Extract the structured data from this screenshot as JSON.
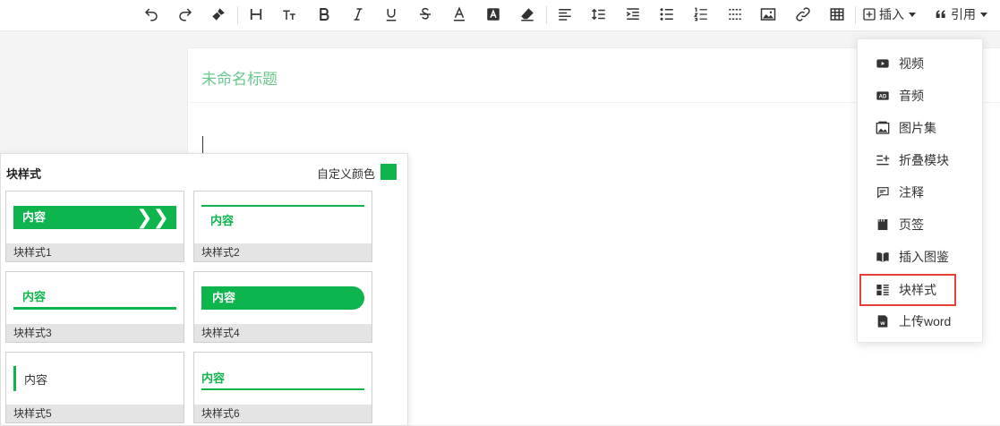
{
  "toolbar": {
    "buttons": [
      "undo-icon",
      "redo-icon",
      "format-brush-icon",
      "heading-icon",
      "font-size-icon",
      "bold-icon",
      "italic-icon",
      "underline-icon",
      "strikethrough-icon",
      "font-color-icon",
      "background-color-icon",
      "eraser-icon",
      "align-icon",
      "line-height-icon",
      "indent-icon",
      "unordered-list-icon",
      "ordered-list-icon",
      "horizontal-rule-icon",
      "image-icon",
      "link-icon",
      "table-icon"
    ],
    "insert_label": "插入",
    "quote_label": "引用"
  },
  "editor": {
    "title_placeholder": "未命名标题"
  },
  "block_panel": {
    "title": "块样式",
    "custom_color_label": "自定义颜色",
    "accent_color": "#0db54c",
    "sample_text": "内容",
    "styles": [
      {
        "name": "块样式1",
        "sample": "内容"
      },
      {
        "name": "块样式2",
        "sample": "内容"
      },
      {
        "name": "块样式3",
        "sample": "内容"
      },
      {
        "name": "块样式4",
        "sample": "内容"
      },
      {
        "name": "块样式5",
        "sample": "内容"
      },
      {
        "name": "块样式6",
        "sample": "内容"
      }
    ]
  },
  "insert_menu": {
    "items": [
      {
        "label": "视频",
        "icon": "video-icon"
      },
      {
        "label": "音频",
        "icon": "audio-icon"
      },
      {
        "label": "图片集",
        "icon": "gallery-icon"
      },
      {
        "label": "折叠模块",
        "icon": "collapse-icon"
      },
      {
        "label": "注释",
        "icon": "comment-icon"
      },
      {
        "label": "页签",
        "icon": "tab-icon"
      },
      {
        "label": "插入图鉴",
        "icon": "book-icon"
      },
      {
        "label": "块样式",
        "icon": "block-style-icon"
      },
      {
        "label": "上传word",
        "icon": "word-icon"
      }
    ],
    "highlighted": "块样式",
    "highlight_color": "#e5413b"
  }
}
